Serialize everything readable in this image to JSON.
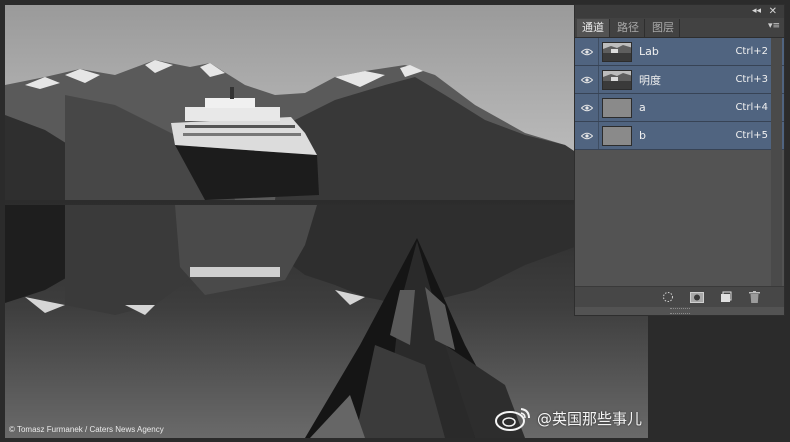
{
  "canvas": {
    "photo_credit": "© Tomasz Furmanek / Caters News Agency",
    "watermark": "@英国那些事儿"
  },
  "panel": {
    "tabs": [
      {
        "label": "通道",
        "active": true
      },
      {
        "label": "路径",
        "active": false
      },
      {
        "label": "图层",
        "active": false
      }
    ],
    "collapse_icon": "double-chevron-left-icon",
    "close_icon": "close-icon",
    "menu_icon": "panel-menu-icon",
    "channels": [
      {
        "name": "Lab",
        "shortcut": "Ctrl+2",
        "visible": true,
        "thumbnail": "photo"
      },
      {
        "name": "明度",
        "shortcut": "Ctrl+3",
        "visible": true,
        "thumbnail": "photo"
      },
      {
        "name": "a",
        "shortcut": "Ctrl+4",
        "visible": true,
        "thumbnail": "flat-gray"
      },
      {
        "name": "b",
        "shortcut": "Ctrl+5",
        "visible": true,
        "thumbnail": "flat-gray"
      }
    ],
    "bottom_buttons": [
      "load-selection-icon",
      "save-mask-icon",
      "new-channel-icon",
      "delete-channel-icon"
    ],
    "colors": {
      "panel_bg": "#535353",
      "row_selected": "#506480",
      "workspace_bg": "#2b2b2b"
    }
  }
}
